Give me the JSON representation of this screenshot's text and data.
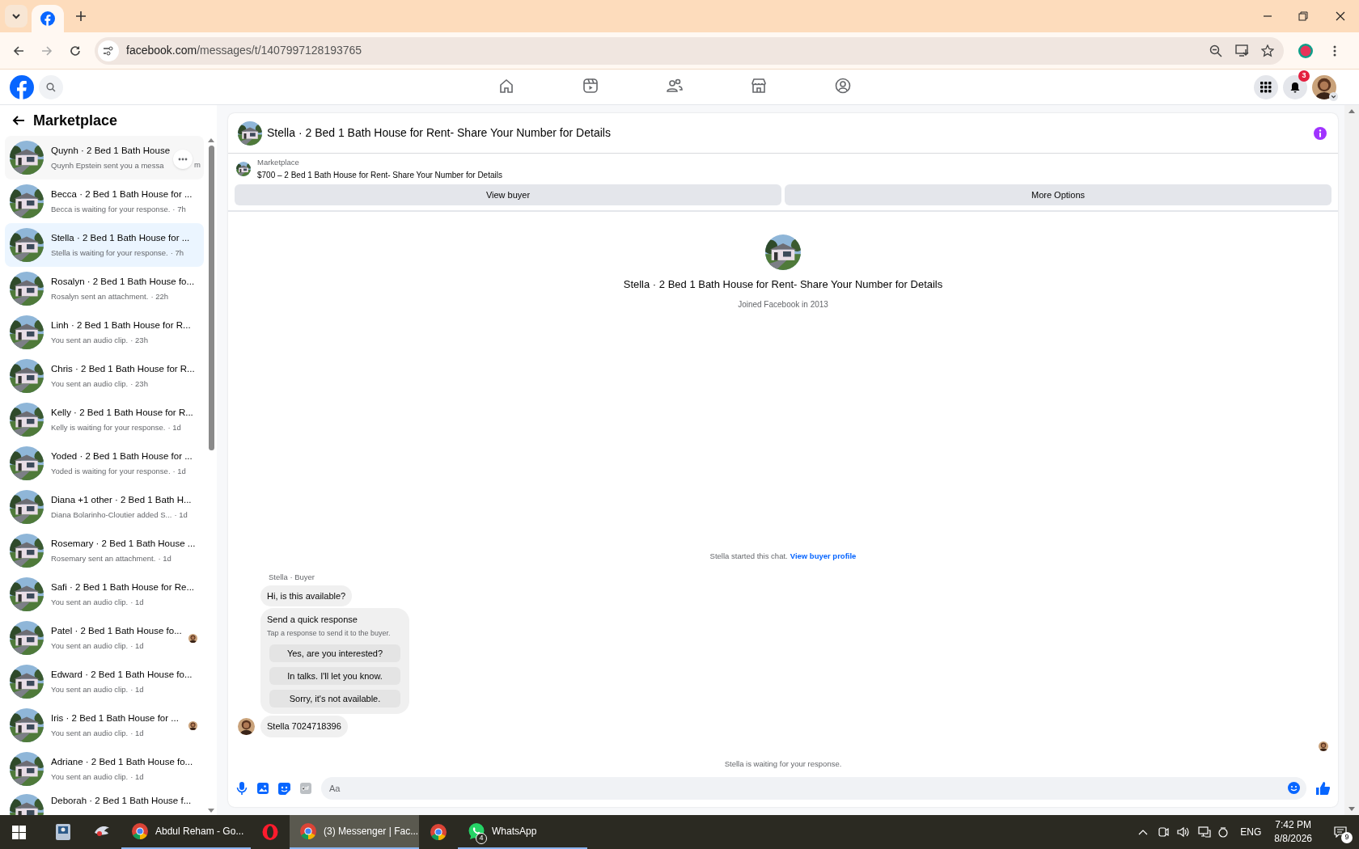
{
  "browser": {
    "url_host": "facebook.com",
    "url_path": "/messages/t/1407997128193765"
  },
  "fb_nav": {
    "notification_count": "3"
  },
  "sidebar": {
    "title": "Marketplace",
    "conversations": [
      {
        "title": "Quynh · 2 Bed 1 Bath House",
        "subtitle": "Quynh Epstein sent you a messa",
        "time": "m",
        "selected": false,
        "hovered": true,
        "seen_avatar": false
      },
      {
        "title": "Becca · 2 Bed 1 Bath House for ...",
        "subtitle": "Becca is waiting for your response.",
        "time": "· 7h",
        "selected": false,
        "hovered": false,
        "seen_avatar": false
      },
      {
        "title": "Stella · 2 Bed 1 Bath House for ...",
        "subtitle": "Stella is waiting for your response.",
        "time": "· 7h",
        "selected": true,
        "hovered": false,
        "seen_avatar": false
      },
      {
        "title": "Rosalyn · 2 Bed 1 Bath House fo...",
        "subtitle": "Rosalyn sent an attachment.",
        "time": "· 22h",
        "selected": false,
        "hovered": false,
        "seen_avatar": false
      },
      {
        "title": "Linh · 2 Bed 1 Bath House for R...",
        "subtitle": "You sent an audio clip.",
        "time": "· 23h",
        "selected": false,
        "hovered": false,
        "seen_avatar": false
      },
      {
        "title": "Chris · 2 Bed 1 Bath House for R...",
        "subtitle": "You sent an audio clip.",
        "time": "· 23h",
        "selected": false,
        "hovered": false,
        "seen_avatar": false
      },
      {
        "title": "Kelly · 2 Bed 1 Bath House for R...",
        "subtitle": "Kelly is waiting for your response.",
        "time": "· 1d",
        "selected": false,
        "hovered": false,
        "seen_avatar": false
      },
      {
        "title": "Yoded · 2 Bed 1 Bath House for ...",
        "subtitle": "Yoded is waiting for your response.",
        "time": "· 1d",
        "selected": false,
        "hovered": false,
        "seen_avatar": false
      },
      {
        "title": "Diana +1 other · 2 Bed 1 Bath H...",
        "subtitle": "Diana Bolarinho-Cloutier added S...",
        "time": "· 1d",
        "selected": false,
        "hovered": false,
        "seen_avatar": false
      },
      {
        "title": "Rosemary · 2 Bed 1 Bath House ...",
        "subtitle": "Rosemary sent an attachment.",
        "time": "· 1d",
        "selected": false,
        "hovered": false,
        "seen_avatar": false
      },
      {
        "title": "Safi · 2 Bed 1 Bath House for Re...",
        "subtitle": "You sent an audio clip.",
        "time": "· 1d",
        "selected": false,
        "hovered": false,
        "seen_avatar": false
      },
      {
        "title": "Patel · 2 Bed 1 Bath House fo...",
        "subtitle": "You sent an audio clip.",
        "time": "· 1d",
        "selected": false,
        "hovered": false,
        "seen_avatar": true
      },
      {
        "title": "Edward · 2 Bed 1 Bath House fo...",
        "subtitle": "You sent an audio clip.",
        "time": "· 1d",
        "selected": false,
        "hovered": false,
        "seen_avatar": false
      },
      {
        "title": "Iris · 2 Bed 1 Bath House for ...",
        "subtitle": "You sent an audio clip.",
        "time": "· 1d",
        "selected": false,
        "hovered": false,
        "seen_avatar": true
      },
      {
        "title": "Adriane · 2 Bed 1 Bath House fo...",
        "subtitle": "You sent an audio clip.",
        "time": "· 1d",
        "selected": false,
        "hovered": false,
        "seen_avatar": false
      },
      {
        "title": "Deborah · 2 Bed 1 Bath House f...",
        "selected": false,
        "hovered": false,
        "seen_avatar": false
      }
    ]
  },
  "chat": {
    "title": "Stella · 2 Bed 1 Bath House for Rent- Share Your Number for Details",
    "listing": {
      "label": "Marketplace",
      "text": "$700 – 2 Bed 1 Bath House for Rent- Share Your Number for Details"
    },
    "buttons": [
      "View buyer",
      "More Options"
    ],
    "profile": {
      "name": "Stella · 2 Bed 1 Bath House for Rent- Share Your Number for Details",
      "joined": "Joined Facebook in 2013"
    },
    "started": {
      "text": "Stella started this chat.",
      "link": "View buyer profile"
    },
    "sender_label": "Stella · Buyer",
    "first_message": "Hi, is this available?",
    "quick_response": {
      "title": "Send a quick response",
      "hint": "Tap a response to send it to the buyer.",
      "options": [
        "Yes, are you interested?",
        "In talks. I'll let you know.",
        "Sorry, it's not available."
      ]
    },
    "last_message": "Stella 7024718396",
    "status": "Stella is waiting for your response.",
    "composer": {
      "placeholder": "Aa"
    }
  },
  "taskbar": {
    "apps": [
      {
        "kind": "id",
        "selected": false,
        "running": false
      },
      {
        "kind": "bird",
        "selected": false,
        "running": false
      },
      {
        "kind": "chrome",
        "label": "Abdul Reham - Go...",
        "selected": false,
        "running": true
      },
      {
        "kind": "opera",
        "selected": false,
        "running": false
      },
      {
        "kind": "chrome",
        "label": "(3) Messenger | Fac...",
        "selected": true,
        "running": true
      },
      {
        "kind": "chrome",
        "selected": false,
        "running": false
      },
      {
        "kind": "whatsapp",
        "label": "WhatsApp",
        "badge": "4",
        "selected": false,
        "running": true
      }
    ],
    "language": "ENG",
    "time": "7:42 PM",
    "date": "8/8/2026",
    "notifications": "9"
  }
}
